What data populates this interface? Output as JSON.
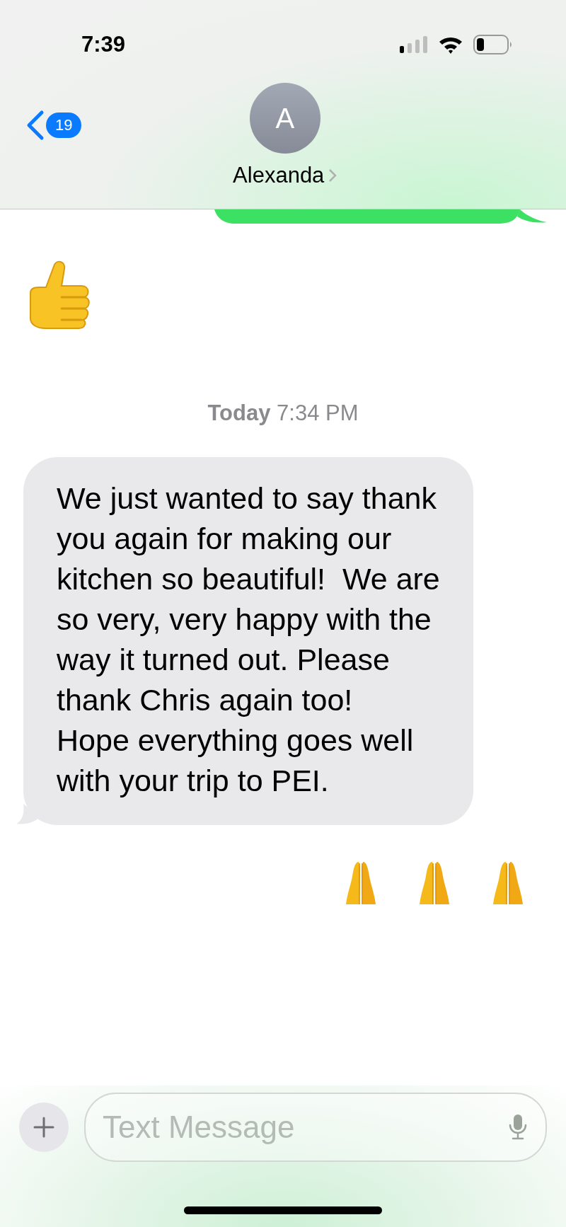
{
  "status_bar": {
    "time": "7:39"
  },
  "header": {
    "back_badge": "19",
    "avatar_initial": "A",
    "contact_name": "Alexanda"
  },
  "messages": [
    {
      "kind": "sent-edge"
    },
    {
      "kind": "thumbs-up"
    },
    {
      "kind": "timestamp",
      "text": "**Today** 7:34 PM"
    },
    {
      "kind": "received",
      "text": "We just wanted to say thank you again for making our kitchen so beautiful!  We are so very, very happy with the way it turned out. Please thank Chris again too!\nHope everything goes well with your trip to PEI."
    },
    {
      "kind": "praying-hands"
    }
  ],
  "composer": {
    "placeholder": "Text Message"
  }
}
